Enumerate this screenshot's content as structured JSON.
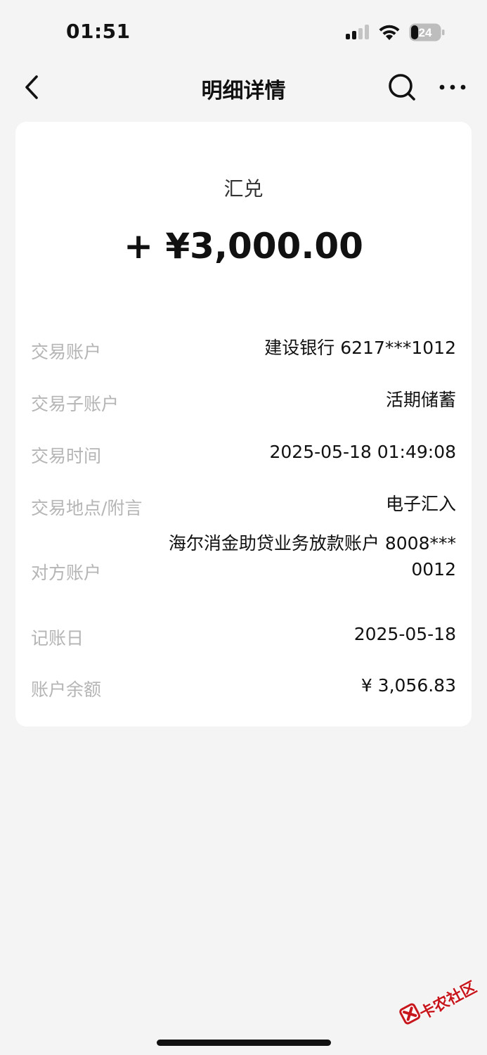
{
  "status_bar": {
    "time": "01:51",
    "battery_level": "24"
  },
  "nav": {
    "title": "明细详情",
    "icons": [
      "chevron-left-icon",
      "search-icon",
      "more-icon"
    ]
  },
  "transaction": {
    "type": "汇兑",
    "amount": "+ ¥3,000.00",
    "details": [
      {
        "label": "交易账户",
        "value": "建设银行 6217***1012"
      },
      {
        "label": "交易子账户",
        "value": "活期储蓄"
      },
      {
        "label": "交易时间",
        "value": "2025-05-18 01:49:08"
      },
      {
        "label": "交易地点/附言",
        "value": "电子汇入"
      },
      {
        "label": "对方账户",
        "value_line1": "海尔消金助贷业务放款账户 8008***",
        "value_line2": "0012"
      },
      {
        "label": "记账日",
        "value": "2025-05-18"
      },
      {
        "label": "账户余额",
        "value": "¥ 3,056.83"
      }
    ]
  },
  "watermark": {
    "text": "卡农社区",
    "color": "#c8161d"
  }
}
